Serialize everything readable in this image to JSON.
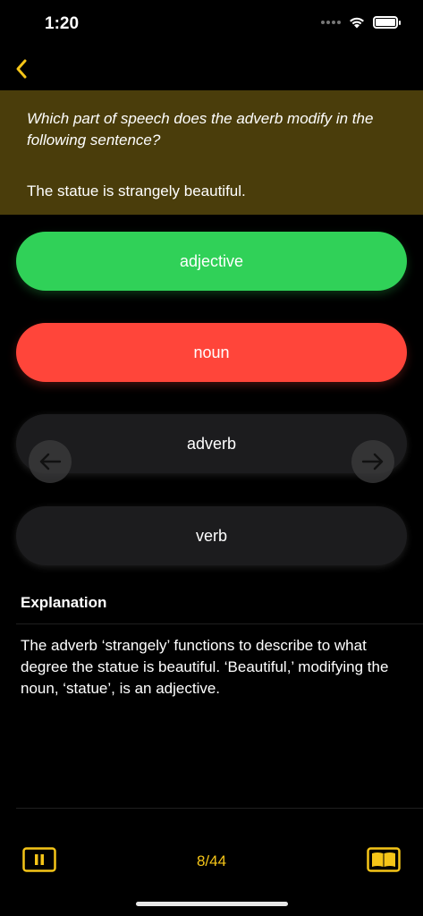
{
  "status_bar": {
    "time": "1:20",
    "icons": [
      "signal-icon",
      "wifi-icon",
      "battery-icon"
    ]
  },
  "colors": {
    "accent": "#f5c518",
    "question_bg": "#4a3d0b",
    "correct": "#30d158",
    "wrong": "#ff453a",
    "neutral": "#1c1c1e"
  },
  "nav": {
    "back_icon": "chevron-left-icon"
  },
  "question": {
    "prompt": "Which part of speech does the adverb modify in the following sentence?",
    "sentence": "The statue is strangely beautiful."
  },
  "answers": [
    {
      "label": "adjective",
      "state": "correct"
    },
    {
      "label": "noun",
      "state": "wrong"
    },
    {
      "label": "adverb",
      "state": "neutral"
    },
    {
      "label": "verb",
      "state": "neutral"
    }
  ],
  "explanation": {
    "title": "Explanation",
    "body": "The adverb ‘strangely’ functions to describe to what degree the statue is beautiful. ‘Beautiful,’ modifying the noun, ‘statue’, is an adjective."
  },
  "footer": {
    "progress": "8/44",
    "pause_icon": "pause-icon",
    "book_icon": "book-icon"
  }
}
